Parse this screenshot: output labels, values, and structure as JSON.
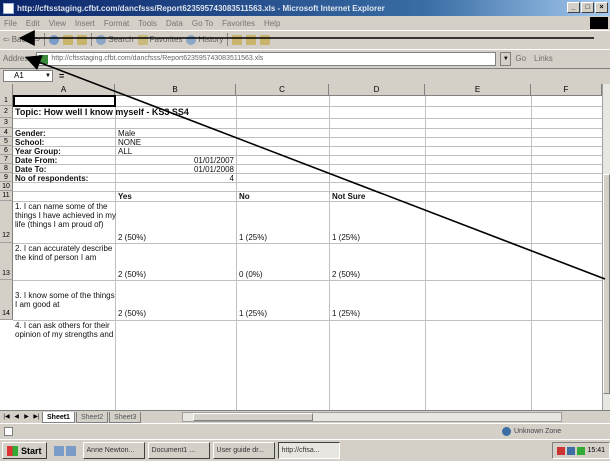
{
  "window": {
    "title": "http://cftsstaging.cfbt.com/dancfsss/Report623595743083511563.xls - Microsoft Internet Explorer",
    "minimize": "_",
    "maximize": "□",
    "close": "×"
  },
  "menubar": {
    "items": [
      "File",
      "Edit",
      "View",
      "Insert",
      "Format",
      "Tools",
      "Data",
      "Go To",
      "Favorites",
      "Help"
    ]
  },
  "toolbar": {
    "back": "Back",
    "search": "Search",
    "favorites": "Favorites",
    "history": "History"
  },
  "addressbar": {
    "label": "Address",
    "url": "http://cftsstaging.cfbt.com/dancfsss/Report623595743083511563.xls",
    "go": "Go",
    "links": "Links"
  },
  "formulabar": {
    "cell_ref": "A1",
    "fx": "="
  },
  "columns": [
    "A",
    "B",
    "C",
    "D",
    "E",
    "F"
  ],
  "rows": [
    "1",
    "2",
    "3",
    "4",
    "5",
    "6",
    "7",
    "8",
    "9",
    "10",
    "11",
    "12",
    "13",
    "14"
  ],
  "sheet": {
    "topic": "Topic: How well I know myself - KS3 SS4",
    "gender_label": "Gender:",
    "gender_value": "Male",
    "school_label": "School:",
    "school_value": "NONE",
    "year_label": "Year Group:",
    "year_value": "ALL",
    "from_label": "Date From:",
    "from_value": "01/01/2007",
    "to_label": "Date To:",
    "to_value": "01/01/2008",
    "resp_label": "No of respondents:",
    "resp_value": "4",
    "hdr_yes": "Yes",
    "hdr_no": "No",
    "hdr_notsure": "Not Sure",
    "q1": "1. I can name some of the things I have achieved in my life (things I am proud of)",
    "q1_yes": "2 (50%)",
    "q1_no": "1 (25%)",
    "q1_notsure": "1 (25%)",
    "q2": "2. I can accurately describe the kind of person I am",
    "q2_yes": "2 (50%)",
    "q2_no": "0 (0%)",
    "q2_notsure": "2 (50%)",
    "q3": "3. I know some of the things I am good at",
    "q3_yes": "2 (50%)",
    "q3_no": "1 (25%)",
    "q3_notsure": "1 (25%)",
    "q4": "4. I can ask others for their opinion of my strengths and"
  },
  "sheettabs": [
    "Sheet1",
    "Sheet2",
    "Sheet3"
  ],
  "statusbar": {
    "zone": "Unknown Zone"
  },
  "taskbar": {
    "start": "Start",
    "tasks": [
      "Anne Newton...",
      "Document1 ...",
      "User guide dr...",
      "http://cftsa..."
    ],
    "clock": "15:41"
  }
}
